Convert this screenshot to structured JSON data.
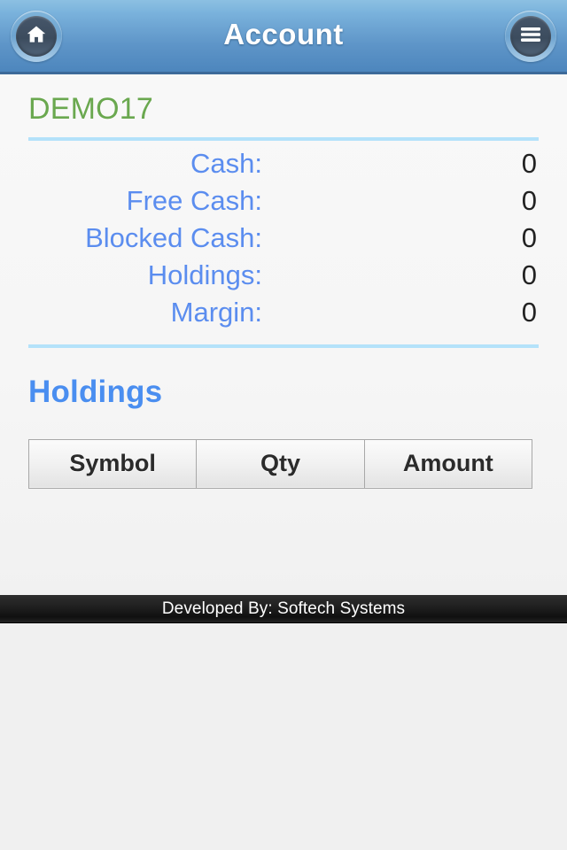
{
  "header": {
    "title": "Account",
    "home_button": {
      "name": "home",
      "icon": "home-icon"
    },
    "menu_button": {
      "name": "menu",
      "icon": "hamburger-menu-icon"
    }
  },
  "account": {
    "name": "DEMO17",
    "name_color": "#6aa84f",
    "label_color": "#5b8def",
    "divider_color": "#b4e2fa",
    "summary": [
      {
        "label": "Cash:",
        "value": "0"
      },
      {
        "label": "Free Cash:",
        "value": "0"
      },
      {
        "label": "Blocked Cash:",
        "value": "0"
      },
      {
        "label": "Holdings:",
        "value": "0"
      },
      {
        "label": "Margin:",
        "value": "0"
      }
    ]
  },
  "holdings": {
    "title": "Holdings",
    "title_color": "#4a8ef0",
    "columns": [
      "Symbol",
      "Qty",
      "Amount"
    ],
    "rows": []
  },
  "footer": {
    "text": "Developed By: Softech Systems"
  }
}
